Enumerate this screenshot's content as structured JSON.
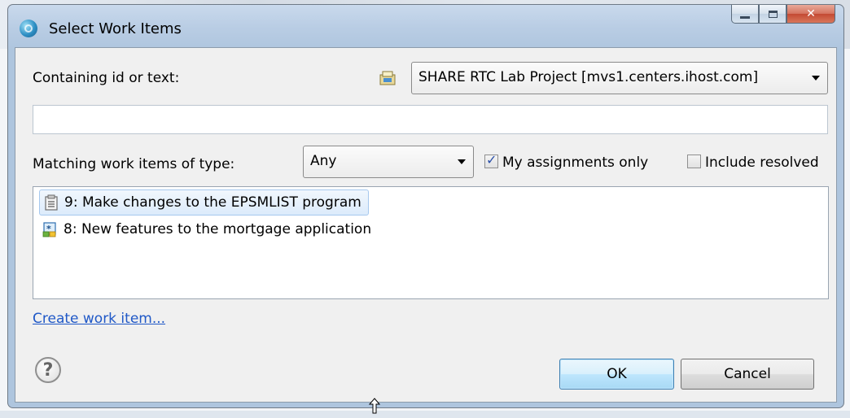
{
  "window": {
    "title": "Select Work Items"
  },
  "search": {
    "containing_label": "Containing id or text:",
    "repository": "SHARE RTC Lab Project [mvs1.centers.ihost.com]",
    "text_value": "",
    "type_label": "Matching work items of type:",
    "type_value": "Any",
    "my_assignments_label": "My assignments only",
    "my_assignments_checked": true,
    "include_resolved_label": "Include resolved",
    "include_resolved_checked": false
  },
  "results": [
    {
      "text": "9: Make changes to the EPSMLIST program",
      "icon": "task-icon",
      "selected": true
    },
    {
      "text": "8: New features to the mortgage application",
      "icon": "story-icon",
      "selected": false
    }
  ],
  "links": {
    "create": "Create work item..."
  },
  "buttons": {
    "help": "?",
    "ok": "OK",
    "cancel": "Cancel"
  },
  "colors": {
    "link": "#1f58c7",
    "selection": "#dcebfb",
    "ok_button": "#bee6fd"
  }
}
